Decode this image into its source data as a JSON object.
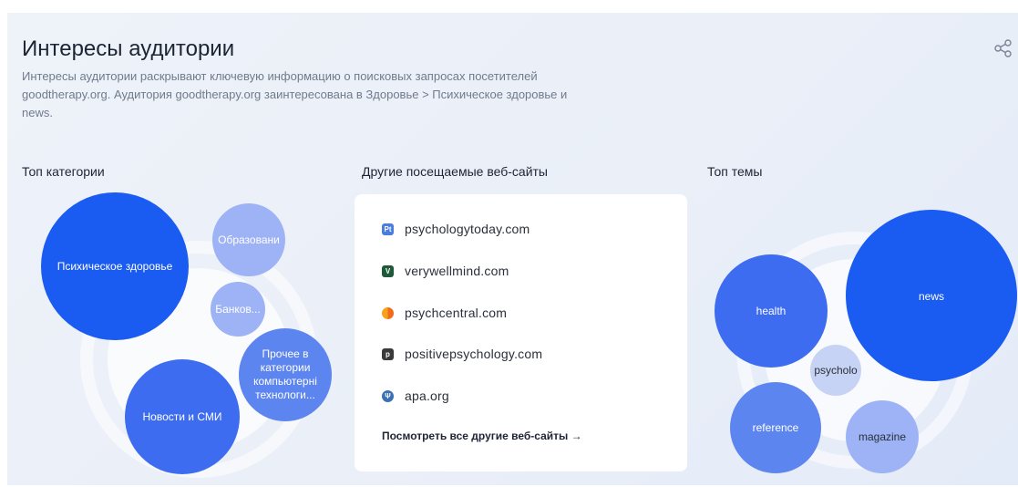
{
  "header": {
    "title": "Интересы аудитории",
    "description": "Интересы аудитории раскрывают ключевую информацию о поисковых запросах посетителей goodtherapy.org. Аудитория goodtherapy.org заинтересована в Здоровье > Психическое здоровье и news."
  },
  "sections": {
    "categories_label": "Топ категории",
    "websites_label": "Другие посещаемые веб-сайты",
    "topics_label": "Топ темы"
  },
  "categories": [
    {
      "label": "Психическое здоровье",
      "color": "#1a5cf2"
    },
    {
      "label": "Образовани",
      "color": "#9db3f5"
    },
    {
      "label": "Банков...",
      "color": "#9db3f5"
    },
    {
      "label": "Прочее в категории компьютерні технологи...",
      "color": "#5d85ef"
    },
    {
      "label": "Новости и СМИ",
      "color": "#3d6cf0"
    }
  ],
  "websites": [
    {
      "name": "psychologytoday.com",
      "icon": "psychologytoday-icon",
      "color": "#4a7de0"
    },
    {
      "name": "verywellmind.com",
      "icon": "verywellmind-icon",
      "color": "#1e5a3a"
    },
    {
      "name": "psychcentral.com",
      "icon": "psychcentral-icon",
      "color": "#f7a21a"
    },
    {
      "name": "positivepsychology.com",
      "icon": "positivepsychology-icon",
      "color": "#3a3a3a"
    },
    {
      "name": "apa.org",
      "icon": "apa-icon",
      "color": "#3b6fb6"
    }
  ],
  "see_all": "Посмотреть все другие веб-сайты →",
  "topics": [
    {
      "label": "news",
      "color": "#1a5cf2"
    },
    {
      "label": "health",
      "color": "#3d6cf0"
    },
    {
      "label": "psycholo",
      "color": "#c7d3f5"
    },
    {
      "label": "reference",
      "color": "#5d85ef"
    },
    {
      "label": "magazine",
      "color": "#9db3f5"
    }
  ]
}
